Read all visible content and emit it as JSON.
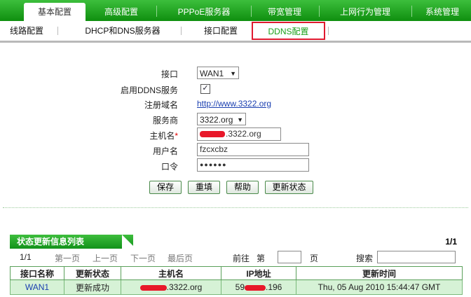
{
  "top_tabs": [
    "基本配置",
    "高级配置",
    "PPPoE服务器",
    "带宽管理",
    "上网行为管理",
    "系统管理"
  ],
  "sub_tabs": [
    "线路配置",
    "DHCP和DNS服务器",
    "接口配置",
    "DDNS配置"
  ],
  "form": {
    "interface_label": "接口",
    "interface_value": "WAN1",
    "enable_label": "启用DDNS服务",
    "enable_checked": "✓",
    "register_label": "注册域名",
    "register_link": "http://www.3322.org",
    "provider_label": "服务商",
    "provider_value": "3322.org",
    "hostname_label": "主机名",
    "hostname_required": "*",
    "hostname_value": ".3322.org",
    "username_label": "用户名",
    "username_value": "fzcxcbz",
    "password_label": "口令",
    "password_value": "●●●●●●"
  },
  "buttons": {
    "save": "保存",
    "reset": "重填",
    "help": "帮助",
    "refresh": "更新状态"
  },
  "list": {
    "title": "状态更新信息列表",
    "count": "1/1",
    "pager": {
      "page": "1/1",
      "first": "第一页",
      "prev": "上一页",
      "next": "下一页",
      "last": "最后页",
      "goto": "前往",
      "di": "第",
      "ye": "页",
      "search": "搜索"
    },
    "headers": [
      "接口名称",
      "更新状态",
      "主机名",
      "IP地址",
      "更新时间"
    ],
    "rows": [
      {
        "iface": "WAN1",
        "status": "更新成功",
        "host": ".3322.org",
        "ip_pre": "59",
        "ip_post": ".196",
        "time": "Thu, 05 Aug 2010 15:44:47 GMT"
      }
    ]
  }
}
